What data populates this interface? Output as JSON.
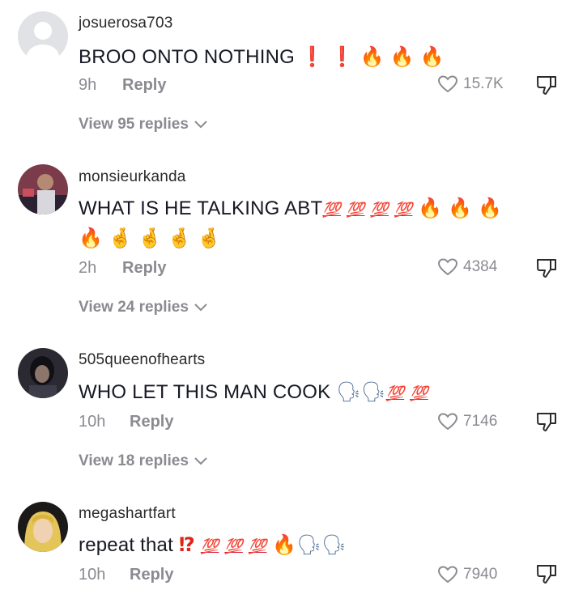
{
  "comments": [
    {
      "username": "josuerosa703",
      "text": "BROO ONTO NOTHING",
      "emojis": [
        "❗",
        "❗",
        "🔥",
        "🔥",
        "🔥"
      ],
      "time": "9h",
      "reply_label": "Reply",
      "likes": "15.7K",
      "view_replies": "View 95 replies"
    },
    {
      "username": "monsieurkanda",
      "text": "WHAT IS HE TALKING ABT",
      "emojis": [
        "💯",
        "💯",
        "💯",
        "💯",
        "🔥",
        "🔥",
        "🔥"
      ],
      "emojis_line2": [
        "🔥",
        "🤞",
        "🤞",
        "🤞",
        "🤞"
      ],
      "time": "2h",
      "reply_label": "Reply",
      "likes": "4384",
      "view_replies": "View 24 replies"
    },
    {
      "username": "505queenofhearts",
      "text": "WHO LET THIS MAN COOK",
      "emojis": [
        "🗣",
        "🗣",
        "💯",
        "💯"
      ],
      "time": "10h",
      "reply_label": "Reply",
      "likes": "7146",
      "view_replies": "View 18 replies"
    },
    {
      "username": "megashartfart",
      "text": "repeat that",
      "emojis": [
        "⁉",
        "💯",
        "💯",
        "💯",
        "🔥",
        "🗣",
        "🗣"
      ],
      "time": "10h",
      "reply_label": "Reply",
      "likes": "7940"
    }
  ],
  "icons": {
    "like": "heart-outline-icon",
    "dislike": "thumbs-down-icon",
    "expand": "chevron-down-icon"
  }
}
